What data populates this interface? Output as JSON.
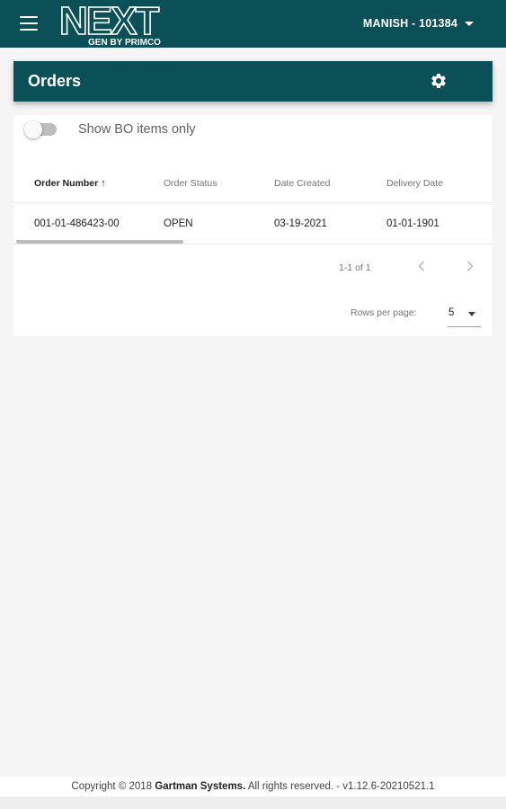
{
  "appbar": {
    "logo_main": "NEXT",
    "logo_sub": "GEN BY PRIMCO",
    "user": "MANISH - 101384",
    "brand_color": "#0b5056"
  },
  "orders": {
    "title": "Orders",
    "settings_icon": "gear-icon"
  },
  "filter": {
    "toggle_label": "Show BO items only",
    "toggle_on": false
  },
  "table": {
    "columns": [
      "Order Number",
      "Order Status",
      "Date Created",
      "Delivery Date"
    ],
    "sorted_column": "Order Number",
    "sort_direction": "ascending",
    "rows": [
      [
        "001-01-486423-00",
        "OPEN",
        "03-19-2021",
        "01-01-1901"
      ]
    ]
  },
  "pagination": {
    "range": "1-1 of 1",
    "rows_per_page_label": "Rows per page:",
    "rows_per_page": "5"
  },
  "footer": {
    "prefix": "Copyright © 2018 ",
    "company": "Gartman Systems.",
    "suffix": " All rights reserved. - v1.12.6-20210521.1"
  }
}
